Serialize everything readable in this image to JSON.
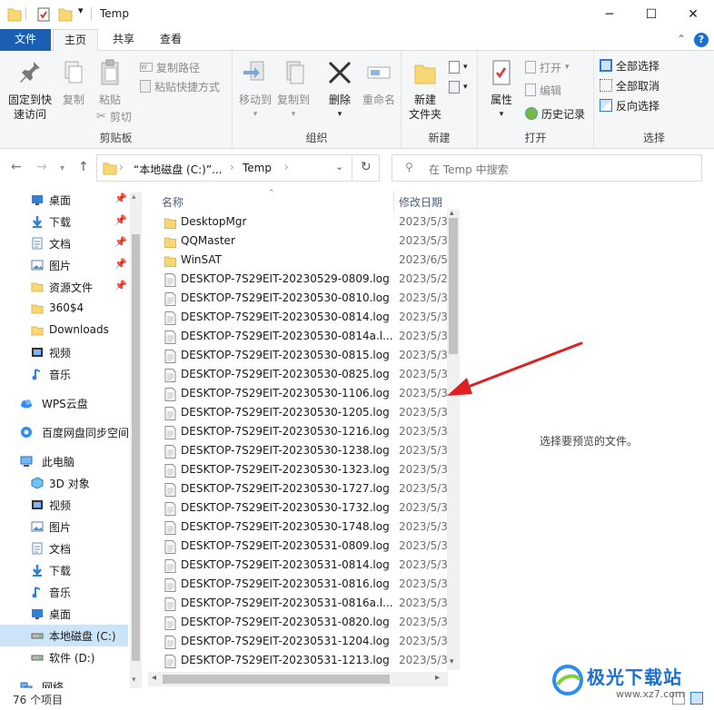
{
  "window": {
    "title": "Temp",
    "min": "─",
    "max": "☐",
    "close": "✕"
  },
  "ribbon_tabs": {
    "file": "文件",
    "home": "主页",
    "share": "共享",
    "view": "查看"
  },
  "ribbon": {
    "pin_quick_access": "固定到快\n速访问",
    "copy": "复制",
    "paste": "粘贴",
    "copy_path": "复制路径",
    "paste_shortcut": "粘贴快捷方式",
    "cut": "剪切",
    "clipboard": "剪贴板",
    "move_to": "移动到",
    "copy_to": "复制到",
    "delete": "删除",
    "rename": "重命名",
    "organize": "组织",
    "new_folder": "新建\n文件夹",
    "new": "新建",
    "properties": "属性",
    "open": "打开",
    "edit": "编辑",
    "history": "历史记录",
    "open_group": "打开",
    "select_all": "全部选择",
    "select_none": "全部取消",
    "invert_selection": "反向选择",
    "select": "选择"
  },
  "address": {
    "root": "“本地磁盘 (C:)”...",
    "sep": "›",
    "current": "Temp",
    "search_placeholder": "在 Temp 中搜索"
  },
  "nav": [
    {
      "label": "桌面",
      "icon": "desktop-icon",
      "pinned": true
    },
    {
      "label": "下载",
      "icon": "download-icon",
      "pinned": true
    },
    {
      "label": "文档",
      "icon": "document-icon",
      "pinned": true
    },
    {
      "label": "图片",
      "icon": "picture-icon",
      "pinned": true
    },
    {
      "label": "资源文件",
      "icon": "folder-icon",
      "pinned": true
    },
    {
      "label": "360$4",
      "icon": "folder-icon",
      "pinned": false
    },
    {
      "label": "Downloads",
      "icon": "folder-icon",
      "pinned": false
    },
    {
      "label": "视频",
      "icon": "video-icon",
      "pinned": false
    },
    {
      "label": "音乐",
      "icon": "music-icon",
      "pinned": false
    },
    {
      "label": "WPS云盘",
      "icon": "cloud-icon",
      "pinned": false
    },
    {
      "label": "百度网盘同步空间",
      "icon": "baidu-icon",
      "pinned": false
    },
    {
      "label": "此电脑",
      "icon": "computer-icon",
      "pinned": false
    },
    {
      "label": "3D 对象",
      "icon": "cube-icon",
      "pinned": false
    },
    {
      "label": "视频",
      "icon": "video-icon",
      "pinned": false
    },
    {
      "label": "图片",
      "icon": "picture-icon",
      "pinned": false
    },
    {
      "label": "文档",
      "icon": "document-icon",
      "pinned": false
    },
    {
      "label": "下载",
      "icon": "download-icon",
      "pinned": false
    },
    {
      "label": "音乐",
      "icon": "music-icon",
      "pinned": false
    },
    {
      "label": "桌面",
      "icon": "desktop-icon",
      "pinned": false
    },
    {
      "label": "本地磁盘 (C:)",
      "icon": "drive-icon",
      "pinned": false
    },
    {
      "label": "软件 (D:)",
      "icon": "drive-icon",
      "pinned": false
    },
    {
      "label": "网络",
      "icon": "network-icon",
      "pinned": false
    }
  ],
  "columns": {
    "name": "名称",
    "date": "修改日期"
  },
  "files": [
    {
      "name": "DesktopMgr",
      "type": "folder",
      "date": "2023/5/3"
    },
    {
      "name": "QQMaster",
      "type": "folder",
      "date": "2023/5/3"
    },
    {
      "name": "WinSAT",
      "type": "folder",
      "date": "2023/6/5"
    },
    {
      "name": "DESKTOP-7S29EIT-20230529-0809.log",
      "type": "file",
      "date": "2023/5/2"
    },
    {
      "name": "DESKTOP-7S29EIT-20230530-0810.log",
      "type": "file",
      "date": "2023/5/3"
    },
    {
      "name": "DESKTOP-7S29EIT-20230530-0814.log",
      "type": "file",
      "date": "2023/5/3"
    },
    {
      "name": "DESKTOP-7S29EIT-20230530-0814a.l...",
      "type": "file",
      "date": "2023/5/3"
    },
    {
      "name": "DESKTOP-7S29EIT-20230530-0815.log",
      "type": "file",
      "date": "2023/5/3"
    },
    {
      "name": "DESKTOP-7S29EIT-20230530-0825.log",
      "type": "file",
      "date": "2023/5/3"
    },
    {
      "name": "DESKTOP-7S29EIT-20230530-1106.log",
      "type": "file",
      "date": "2023/5/3"
    },
    {
      "name": "DESKTOP-7S29EIT-20230530-1205.log",
      "type": "file",
      "date": "2023/5/3"
    },
    {
      "name": "DESKTOP-7S29EIT-20230530-1216.log",
      "type": "file",
      "date": "2023/5/3"
    },
    {
      "name": "DESKTOP-7S29EIT-20230530-1238.log",
      "type": "file",
      "date": "2023/5/3"
    },
    {
      "name": "DESKTOP-7S29EIT-20230530-1323.log",
      "type": "file",
      "date": "2023/5/3"
    },
    {
      "name": "DESKTOP-7S29EIT-20230530-1727.log",
      "type": "file",
      "date": "2023/5/3"
    },
    {
      "name": "DESKTOP-7S29EIT-20230530-1732.log",
      "type": "file",
      "date": "2023/5/3"
    },
    {
      "name": "DESKTOP-7S29EIT-20230530-1748.log",
      "type": "file",
      "date": "2023/5/3"
    },
    {
      "name": "DESKTOP-7S29EIT-20230531-0809.log",
      "type": "file",
      "date": "2023/5/3"
    },
    {
      "name": "DESKTOP-7S29EIT-20230531-0814.log",
      "type": "file",
      "date": "2023/5/3"
    },
    {
      "name": "DESKTOP-7S29EIT-20230531-0816.log",
      "type": "file",
      "date": "2023/5/3"
    },
    {
      "name": "DESKTOP-7S29EIT-20230531-0816a.l...",
      "type": "file",
      "date": "2023/5/3"
    },
    {
      "name": "DESKTOP-7S29EIT-20230531-0820.log",
      "type": "file",
      "date": "2023/5/3"
    },
    {
      "name": "DESKTOP-7S29EIT-20230531-1204.log",
      "type": "file",
      "date": "2023/5/3"
    },
    {
      "name": "DESKTOP-7S29EIT-20230531-1213.log",
      "type": "file",
      "date": "2023/5/3"
    }
  ],
  "preview_text": "选择要预览的文件。",
  "status": {
    "count": "76 个项目"
  },
  "watermark": {
    "text": "极光下载站",
    "url": "www.xz7.com"
  },
  "colors": {
    "accent": "#1a5fb4",
    "folder": "#f8d775",
    "arrow": "#e02020"
  }
}
